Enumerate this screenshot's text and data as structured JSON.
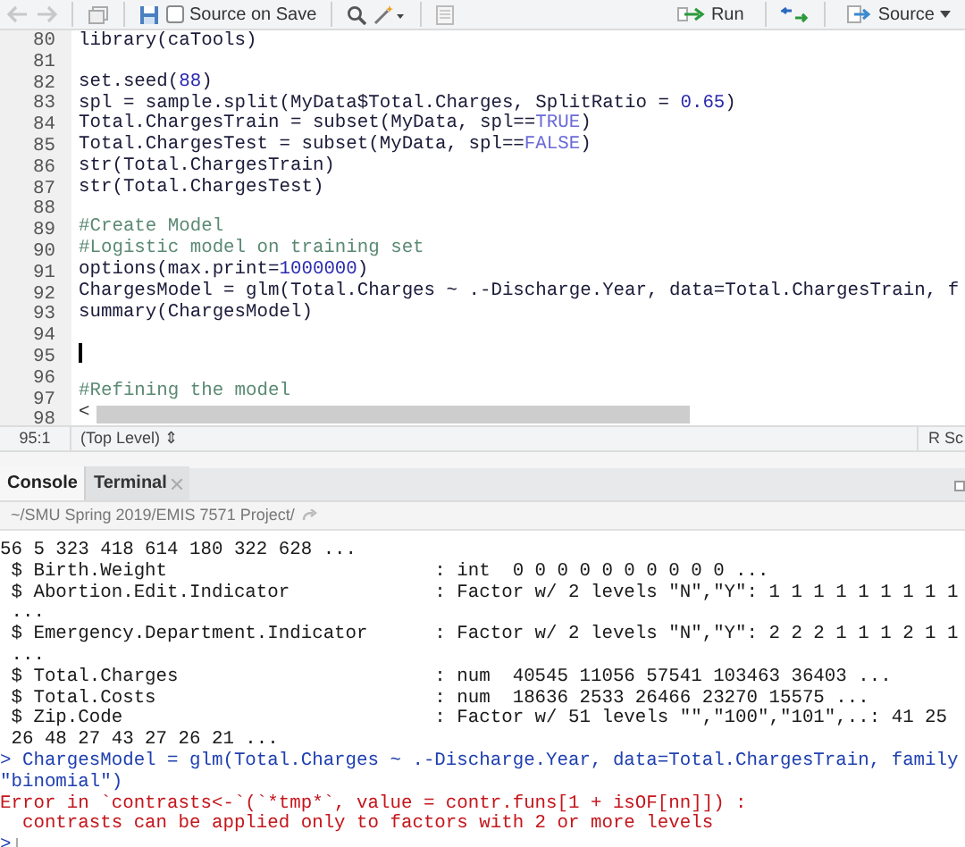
{
  "toolbar": {
    "source_on_save": {
      "label": "Source on Save",
      "checked": false
    },
    "run": "Run",
    "source": "Source"
  },
  "editor": {
    "lines": [
      {
        "number": "80",
        "tokens": [
          {
            "t": "library(caTools)",
            "kind": "plain"
          }
        ]
      },
      {
        "number": "81"
      },
      {
        "number": "82",
        "tokens": [
          {
            "t": "set.seed(",
            "kind": "plain"
          },
          {
            "t": "88",
            "kind": "number"
          },
          {
            "t": ")",
            "kind": "plain"
          }
        ]
      },
      {
        "number": "83",
        "tokens": [
          {
            "t": "spl = sample.split(MyData$Total.Charges, SplitRatio = ",
            "kind": "plain"
          },
          {
            "t": "0.65",
            "kind": "number"
          },
          {
            "t": ")",
            "kind": "plain"
          }
        ]
      },
      {
        "number": "84",
        "tokens": [
          {
            "t": "Total.ChargesTrain = subset(MyData, spl==",
            "kind": "plain"
          },
          {
            "t": "TRUE",
            "kind": "constant"
          },
          {
            "t": ")",
            "kind": "plain"
          }
        ]
      },
      {
        "number": "85",
        "tokens": [
          {
            "t": "Total.ChargesTest = subset(MyData, spl==",
            "kind": "plain"
          },
          {
            "t": "FALSE",
            "kind": "constant"
          },
          {
            "t": ")",
            "kind": "plain"
          }
        ]
      },
      {
        "number": "86",
        "tokens": [
          {
            "t": "str(Total.ChargesTrain)",
            "kind": "plain"
          }
        ]
      },
      {
        "number": "87",
        "tokens": [
          {
            "t": "str(Total.ChargesTest)",
            "kind": "plain"
          }
        ]
      },
      {
        "number": "88"
      },
      {
        "number": "89",
        "tokens": [
          {
            "t": "#Create Model",
            "kind": "comment"
          }
        ]
      },
      {
        "number": "90",
        "tokens": [
          {
            "t": "#Logistic model on training set",
            "kind": "comment"
          }
        ]
      },
      {
        "number": "91",
        "tokens": [
          {
            "t": "options(max.print=",
            "kind": "plain"
          },
          {
            "t": "1000000",
            "kind": "number"
          },
          {
            "t": ")",
            "kind": "plain"
          }
        ]
      },
      {
        "number": "92",
        "tokens": [
          {
            "t": "ChargesModel = glm(Total.Charges ~ .-Discharge.Year, data=Total.ChargesTrain, f",
            "kind": "plain"
          }
        ]
      },
      {
        "number": "93",
        "tokens": [
          {
            "t": "summary(ChargesModel)",
            "kind": "plain"
          }
        ]
      },
      {
        "number": "94"
      },
      {
        "number": "95",
        "cursor": true
      },
      {
        "number": "96"
      },
      {
        "number": "97",
        "tokens": [
          {
            "t": "#Refining the model",
            "kind": "comment"
          }
        ]
      }
    ],
    "last_line_number": "98",
    "scroll_left": "<"
  },
  "status_bar": {
    "position": "95:1",
    "scope": "(Top Level) ⇕",
    "file_type": "R Sc"
  },
  "tabs": [
    {
      "label": "Console",
      "selected": true,
      "closable": false
    },
    {
      "label": "Terminal",
      "selected": false,
      "closable": true
    }
  ],
  "console": {
    "path": "~/SMU Spring 2019/EMIS 7571 Project/",
    "lines": [
      {
        "kind": "output",
        "text": "56 5 323 418 614 180 322 628 ..."
      },
      {
        "kind": "output",
        "text": " $ Birth.Weight                        : int  0 0 0 0 0 0 0 0 0 0 ..."
      },
      {
        "kind": "output",
        "text": " $ Abortion.Edit.Indicator             : Factor w/ 2 levels \"N\",\"Y\": 1 1 1 1 1 1 1 1 1"
      },
      {
        "kind": "output",
        "text": " ..."
      },
      {
        "kind": "output",
        "text": " $ Emergency.Department.Indicator      : Factor w/ 2 levels \"N\",\"Y\": 2 2 2 1 1 1 2 1 1"
      },
      {
        "kind": "output",
        "text": " ..."
      },
      {
        "kind": "output",
        "text": " $ Total.Charges                       : num  40545 11056 57541 103463 36403 ..."
      },
      {
        "kind": "output",
        "text": " $ Total.Costs                         : num  18636 2533 26466 23270 15575 ..."
      },
      {
        "kind": "output",
        "text": " $ Zip.Code                            : Factor w/ 51 levels \"\",\"100\",\"101\",..: 41 25"
      },
      {
        "kind": "output",
        "text": " 26 48 27 43 27 26 21 ..."
      },
      {
        "kind": "command",
        "text": "> ChargesModel = glm(Total.Charges ~ .-Discharge.Year, data=Total.ChargesTrain, family"
      },
      {
        "kind": "command",
        "text": "\"binomial\")"
      },
      {
        "kind": "error",
        "text": "Error in `contrasts<-`(`*tmp*`, value = contr.funs[1 + isOF[nn]]) :"
      },
      {
        "kind": "error",
        "text": "  contrasts can be applied only to factors with 2 or more levels"
      },
      {
        "kind": "prompt",
        "text": ">"
      }
    ]
  }
}
